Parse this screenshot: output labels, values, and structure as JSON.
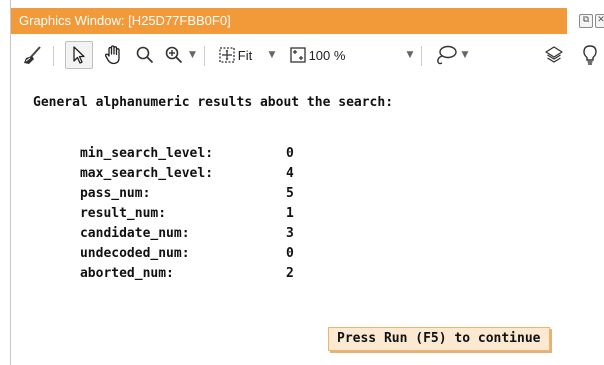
{
  "window": {
    "title": "Graphics Window: [H25D77FBB0F0]"
  },
  "toolbar": {
    "fit_label": "Fit",
    "zoom_label": "100 %",
    "icons": [
      "broom-icon",
      "pointer-icon",
      "hand-icon",
      "magnifier-icon",
      "zoom-in-icon",
      "fit-icon",
      "zoom-percent-icon",
      "lasso-icon",
      "layers-icon",
      "bulb-icon"
    ]
  },
  "results": {
    "heading": "General alphanumeric results about the search:",
    "rows": [
      {
        "key": "min_search_level:",
        "value": "0"
      },
      {
        "key": "max_search_level:",
        "value": "4"
      },
      {
        "key": "pass_num:",
        "value": "5"
      },
      {
        "key": "result_num:",
        "value": "1"
      },
      {
        "key": "candidate_num:",
        "value": "3"
      },
      {
        "key": "undecoded_num:",
        "value": "0"
      },
      {
        "key": "aborted_num:",
        "value": "2"
      }
    ]
  },
  "status": {
    "message": "Press Run (F5) to continue"
  },
  "colors": {
    "title_bar": "#f29a3a",
    "status_bg": "#fbe9d1",
    "status_border": "#f2b36a"
  }
}
